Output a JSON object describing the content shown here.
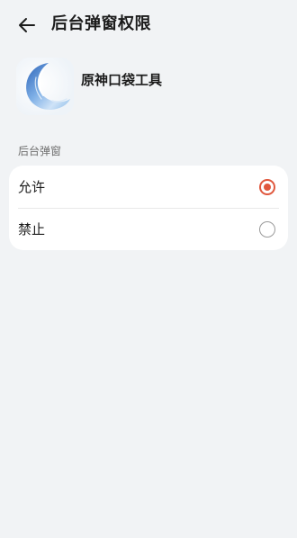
{
  "header": {
    "title": "后台弹窗权限",
    "back_icon": "arrow-left-icon"
  },
  "app": {
    "name": "原神口袋工具",
    "icon": "crescent-moon-app-icon"
  },
  "section": {
    "label": "后台弹窗"
  },
  "options": [
    {
      "label": "允许",
      "selected": true
    },
    {
      "label": "禁止",
      "selected": false
    }
  ],
  "colors": {
    "background": "#f1f3f5",
    "card": "#ffffff",
    "accent": "#e0583e",
    "radio_off": "#9a9a9a"
  }
}
